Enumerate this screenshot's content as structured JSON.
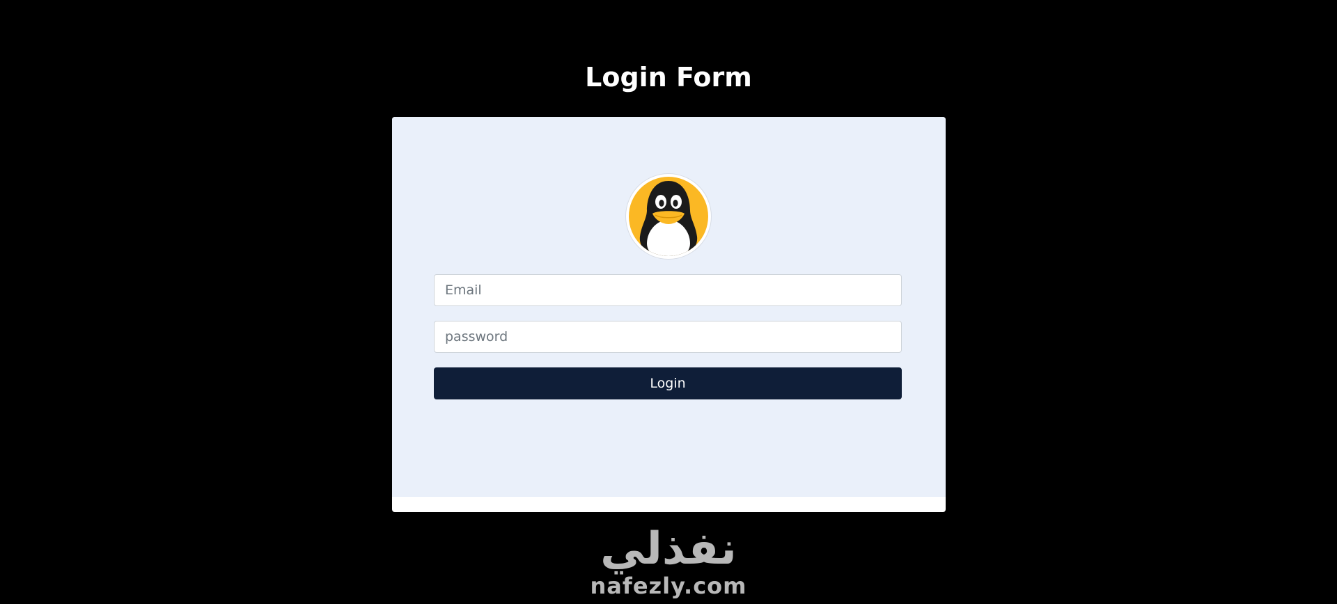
{
  "page": {
    "title": "Login Form"
  },
  "avatar": {
    "icon": "penguin-icon"
  },
  "form": {
    "email_placeholder": "Email",
    "email_value": "",
    "password_placeholder": "password",
    "password_value": "",
    "login_label": "Login"
  },
  "watermark": {
    "arabic": "نفذلي",
    "latin": "nafezly.com"
  },
  "colors": {
    "background": "#000000",
    "card": "#eaf0fa",
    "button": "#0f1e38",
    "avatar_accent": "#fbb824"
  }
}
